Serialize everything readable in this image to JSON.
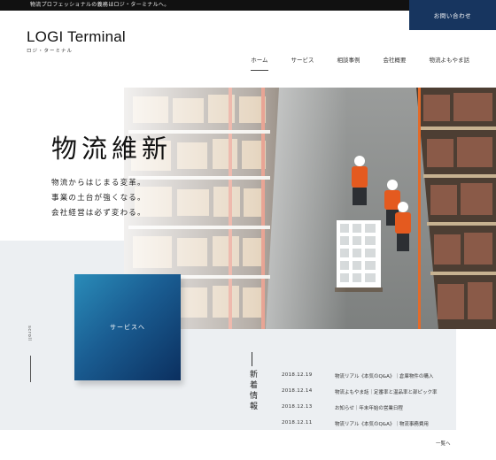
{
  "topbar": {
    "text": "物流プロフェッショナルの義務はロジ・ターミナルへ。"
  },
  "contact": {
    "label": "お問い合わせ"
  },
  "logo": {
    "name": "LOGI Terminal",
    "kana": "ロジ・ターミナル"
  },
  "nav": {
    "items": [
      "ホーム",
      "サービス",
      "相談事例",
      "会社概要",
      "物流よもやま話"
    ],
    "active": "ホーム"
  },
  "hero": {
    "title": "物流維新",
    "lines": [
      "物流からはじまる変革。",
      "事業の土台が強くなる。",
      "会社経営は必ず変わる。"
    ]
  },
  "service_button": {
    "label": "サービスへ"
  },
  "scroll": {
    "label": "scroll"
  },
  "news": {
    "heading": "新着情報",
    "items": [
      {
        "date": "2018.12.19",
        "title": "物流リアル《本気のQ&A》｜倉庫物件の購入"
      },
      {
        "date": "2018.12.14",
        "title": "物流よもやま話｜定番率と温品率と部ピック率"
      },
      {
        "date": "2018.12.13",
        "title": "お知らせ｜年末年始の営業日程"
      },
      {
        "date": "2018.12.11",
        "title": "物流リアル《本気のQ&A》｜物流事務費用"
      }
    ],
    "more": "一覧へ"
  },
  "colors": {
    "accent": "#17355f",
    "service_gradient": [
      "#2a8cb9",
      "#0b2f5f"
    ],
    "panel_gray": "#eceff2"
  }
}
